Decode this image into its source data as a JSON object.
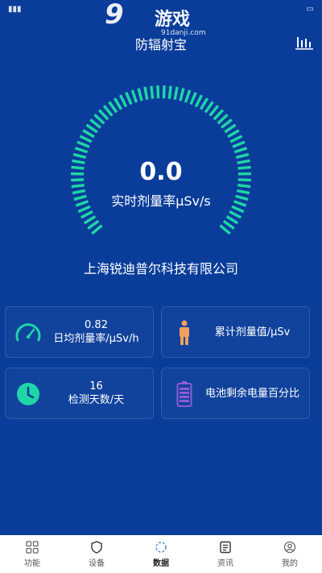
{
  "watermark": {
    "brand_nine": "9",
    "brand_cn": "游戏",
    "url": "91danji.com"
  },
  "header": {
    "title": "防辐射宝",
    "stats_icon": "bar-chart-icon"
  },
  "gauge": {
    "reading": "0.0",
    "label": "实时剂量率μSv/s",
    "accent": "#1fd6a6"
  },
  "company": "上海锐迪普尔科技有限公司",
  "cards": [
    {
      "value": "0.82",
      "label": "日均剂量率/μSv/h",
      "icon": "speedometer-icon"
    },
    {
      "value": "",
      "label": "累计剂量值/μSv",
      "icon": "person-icon"
    },
    {
      "value": "16",
      "label": "检测天数/天",
      "icon": "clock-icon"
    },
    {
      "value": "",
      "label": "电池剩余电量百分比",
      "icon": "battery-icon"
    }
  ],
  "nav": [
    {
      "label": "功能",
      "icon": "grid-icon"
    },
    {
      "label": "设备",
      "icon": "shield-icon"
    },
    {
      "label": "数据",
      "icon": "data-icon",
      "active": true
    },
    {
      "label": "资讯",
      "icon": "news-icon"
    },
    {
      "label": "我的",
      "icon": "profile-icon"
    }
  ]
}
